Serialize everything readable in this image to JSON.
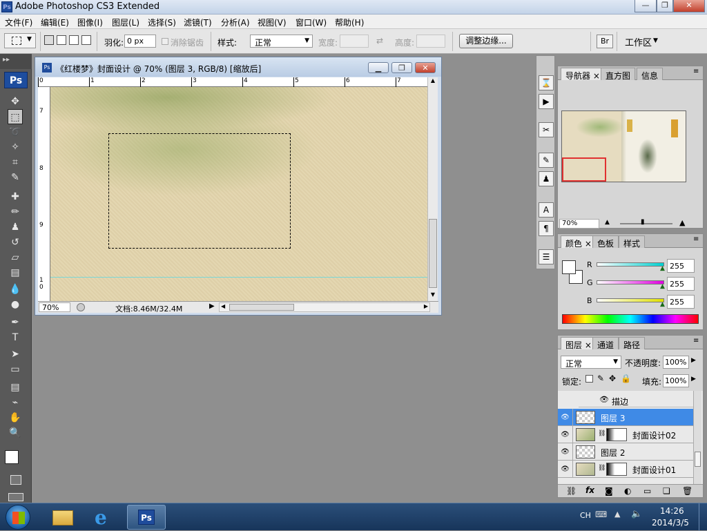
{
  "app": {
    "title": "Adobe Photoshop CS3 Extended",
    "ps_icon": "Ps",
    "window_buttons": {
      "minimize": "—",
      "restore": "❐",
      "close": "✕"
    }
  },
  "menu": [
    "文件(F)",
    "编辑(E)",
    "图像(I)",
    "图层(L)",
    "选择(S)",
    "滤镜(T)",
    "分析(A)",
    "视图(V)",
    "窗口(W)",
    "帮助(H)"
  ],
  "options": {
    "feather_label": "羽化:",
    "feather_value": "0 px",
    "antialias_label": "消除锯齿",
    "style_label": "样式:",
    "style_value": "正常",
    "width_label": "宽度:",
    "height_label": "高度:",
    "refine_edge_label": "调整边缘...",
    "workspace_label": "工作区"
  },
  "toolbox": {
    "logo": "Ps",
    "tools": [
      {
        "name": "move-tool",
        "glyph": "✥",
        "selected": false
      },
      {
        "name": "marquee-tool",
        "glyph": "⬚",
        "selected": true
      },
      {
        "name": "lasso-tool",
        "glyph": "➰",
        "selected": false
      },
      {
        "name": "magic-wand-tool",
        "glyph": "✧",
        "selected": false
      },
      {
        "name": "crop-tool",
        "glyph": "⌗",
        "selected": false
      },
      {
        "name": "slice-tool",
        "glyph": "✎",
        "selected": false
      },
      {
        "name": "healing-brush-tool",
        "glyph": "✚",
        "selected": false
      },
      {
        "name": "brush-tool",
        "glyph": "✏",
        "selected": false
      },
      {
        "name": "clone-stamp-tool",
        "glyph": "♟",
        "selected": false
      },
      {
        "name": "history-brush-tool",
        "glyph": "↺",
        "selected": false
      },
      {
        "name": "eraser-tool",
        "glyph": "▱",
        "selected": false
      },
      {
        "name": "gradient-tool",
        "glyph": "▤",
        "selected": false
      },
      {
        "name": "blur-tool",
        "glyph": "💧",
        "selected": false
      },
      {
        "name": "dodge-tool",
        "glyph": "●",
        "selected": false
      },
      {
        "name": "pen-tool",
        "glyph": "✒",
        "selected": false
      },
      {
        "name": "type-tool",
        "glyph": "T",
        "selected": false
      },
      {
        "name": "path-selection-tool",
        "glyph": "➤",
        "selected": false
      },
      {
        "name": "shape-tool",
        "glyph": "▭",
        "selected": false
      },
      {
        "name": "notes-tool",
        "glyph": "▤",
        "selected": false
      },
      {
        "name": "eyedropper-tool",
        "glyph": "⌁",
        "selected": false
      },
      {
        "name": "hand-tool",
        "glyph": "✋",
        "selected": false
      },
      {
        "name": "zoom-tool",
        "glyph": "🔍",
        "selected": false
      }
    ]
  },
  "document": {
    "title": "《红楼梦》封面设计 @ 70% (图层 3, RGB/8) [缩放后]",
    "zoom": "70%",
    "doc_size": "文档:8.46M/32.4M",
    "ruler_top": [
      "0",
      "1",
      "2",
      "3",
      "4",
      "5",
      "6",
      "7"
    ],
    "ruler_left": [
      "7",
      "8",
      "9",
      "1\n0"
    ]
  },
  "navigator": {
    "tabs": [
      "导航器",
      "直方图",
      "信息"
    ],
    "zoom": "70%"
  },
  "color": {
    "tabs": [
      "颜色",
      "色板",
      "样式"
    ],
    "channels": [
      {
        "label": "R",
        "value": "255",
        "grad": "#00d0d0"
      },
      {
        "label": "G",
        "value": "255",
        "grad": "#e000e0"
      },
      {
        "label": "B",
        "value": "255",
        "grad": "#e0e000"
      }
    ]
  },
  "layers": {
    "tabs": [
      "图层",
      "通道",
      "路径"
    ],
    "blend_mode": "正常",
    "opacity_label": "不透明度:",
    "opacity_value": "100%",
    "lock_label": "锁定:",
    "fill_label": "填充:",
    "fill_value": "100%",
    "effect_label": "描边",
    "items": [
      {
        "name": "图层 3",
        "selected": true,
        "has_mask": false
      },
      {
        "name": "封面设计02",
        "selected": false,
        "has_mask": true
      },
      {
        "name": "图层 2",
        "selected": false,
        "has_mask": false
      },
      {
        "name": "封面设计01",
        "selected": false,
        "has_mask": true
      }
    ]
  },
  "taskbar": {
    "lang": "CH",
    "time": "14:26",
    "date": "2014/3/5"
  }
}
